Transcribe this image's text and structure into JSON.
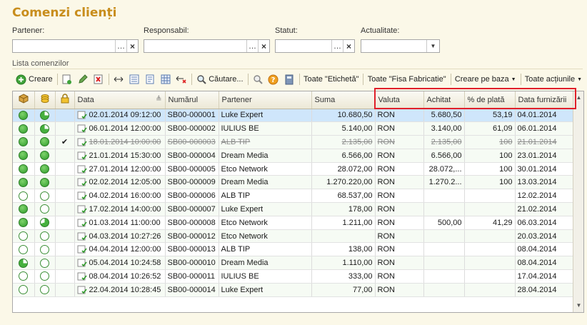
{
  "window_title": "Comenzi clienți",
  "filters": {
    "partner_label": "Partener:",
    "partner_value": "",
    "responsible_label": "Responsabil:",
    "responsible_value": "",
    "status_label": "Statut:",
    "status_value": "",
    "actuality_label": "Actualitate:",
    "actuality_value": ""
  },
  "list_label": "Lista comenzilor",
  "toolbar": {
    "create_label": "Creare",
    "search_label": "Căutare...",
    "all_labels_label": "Toate \"Etichetă\"",
    "all_fab_label": "Toate \"Fisa Fabricatie\"",
    "create_based_label": "Creare pe baza",
    "all_actions_label": "Toate acțiunile"
  },
  "columns": {
    "data": "Data",
    "number": "Numărul",
    "partner": "Partener",
    "sum": "Suma",
    "currency": "Valuta",
    "paid": "Achitat",
    "pct": "% de plată",
    "delivery": "Data furnizării"
  },
  "rows": [
    {
      "s1": "full",
      "s2": "part",
      "lock": "",
      "date": "02.01.2014 09:12:00",
      "number": "SB00-000001",
      "partner": "Luke Expert",
      "sum": "10.680,50",
      "currency": "RON",
      "paid": "5.680,50",
      "pct": "53,19",
      "delivery": "04.01.2014"
    },
    {
      "s1": "full",
      "s2": "part",
      "lock": "",
      "date": "06.01.2014 12:00:00",
      "number": "SB00-000002",
      "partner": "IULIUS BE",
      "sum": "5.140,00",
      "currency": "RON",
      "paid": "3.140,00",
      "pct": "61,09",
      "delivery": "06.01.2014"
    },
    {
      "s1": "full",
      "s2": "full",
      "lock": "✔",
      "date": "18.01.2014 10:00:00",
      "number": "SB00-000003",
      "partner": "ALB TIP",
      "sum": "2.135,00",
      "currency": "RON",
      "paid": "2.135,00",
      "pct": "100",
      "delivery": "21.01.2014"
    },
    {
      "s1": "full",
      "s2": "full",
      "lock": "",
      "date": "21.01.2014 15:30:00",
      "number": "SB00-000004",
      "partner": "Dream Media",
      "sum": "6.566,00",
      "currency": "RON",
      "paid": "6.566,00",
      "pct": "100",
      "delivery": "23.01.2014"
    },
    {
      "s1": "full",
      "s2": "full",
      "lock": "",
      "date": "27.01.2014 12:00:00",
      "number": "SB00-000005",
      "partner": "Etco Network",
      "sum": "28.072,00",
      "currency": "RON",
      "paid": "28.072,...",
      "pct": "100",
      "delivery": "30.01.2014"
    },
    {
      "s1": "full",
      "s2": "full",
      "lock": "",
      "date": "02.02.2014 12:05:00",
      "number": "SB00-000009",
      "partner": "Dream Media",
      "sum": "1.270.220,00",
      "currency": "RON",
      "paid": "1.270.2...",
      "pct": "100",
      "delivery": "13.03.2014"
    },
    {
      "s1": "empty",
      "s2": "empty",
      "lock": "",
      "date": "04.02.2014 16:00:00",
      "number": "SB00-000006",
      "partner": "ALB TIP",
      "sum": "68.537,00",
      "currency": "RON",
      "paid": "",
      "pct": "",
      "delivery": "12.02.2014"
    },
    {
      "s1": "full",
      "s2": "empty",
      "lock": "",
      "date": "17.02.2014 14:00:00",
      "number": "SB00-000007",
      "partner": "Luke Expert",
      "sum": "178,00",
      "currency": "RON",
      "paid": "",
      "pct": "",
      "delivery": "21.02.2014"
    },
    {
      "s1": "full",
      "s2": "part2",
      "lock": "",
      "date": "01.03.2014 11:00:00",
      "number": "SB00-000008",
      "partner": "Etco Network",
      "sum": "1.211,00",
      "currency": "RON",
      "paid": "500,00",
      "pct": "41,29",
      "delivery": "06.03.2014"
    },
    {
      "s1": "empty",
      "s2": "empty",
      "lock": "",
      "date": "04.03.2014 10:27:26",
      "number": "SB00-000012",
      "partner": "Etco Network",
      "sum": "",
      "currency": "RON",
      "paid": "",
      "pct": "",
      "delivery": "20.03.2014"
    },
    {
      "s1": "empty",
      "s2": "empty",
      "lock": "",
      "date": "04.04.2014 12:00:00",
      "number": "SB00-000013",
      "partner": "ALB TIP",
      "sum": "138,00",
      "currency": "RON",
      "paid": "",
      "pct": "",
      "delivery": "08.04.2014"
    },
    {
      "s1": "part",
      "s2": "empty",
      "lock": "",
      "date": "05.04.2014 10:24:58",
      "number": "SB00-000010",
      "partner": "Dream Media",
      "sum": "1.110,00",
      "currency": "RON",
      "paid": "",
      "pct": "",
      "delivery": "08.04.2014"
    },
    {
      "s1": "empty",
      "s2": "empty",
      "lock": "",
      "date": "08.04.2014 10:26:52",
      "number": "SB00-000011",
      "partner": "IULIUS BE",
      "sum": "333,00",
      "currency": "RON",
      "paid": "",
      "pct": "",
      "delivery": "17.04.2014"
    },
    {
      "s1": "empty",
      "s2": "empty",
      "lock": "",
      "date": "22.04.2014 10:28:45",
      "number": "SB00-000014",
      "partner": "Luke Expert",
      "sum": "77,00",
      "currency": "RON",
      "paid": "",
      "pct": "",
      "delivery": "28.04.2014"
    }
  ],
  "colors": {
    "title": "#c88d1c",
    "highlight": "#e0202a",
    "selected_row": "#cfe6fb"
  }
}
